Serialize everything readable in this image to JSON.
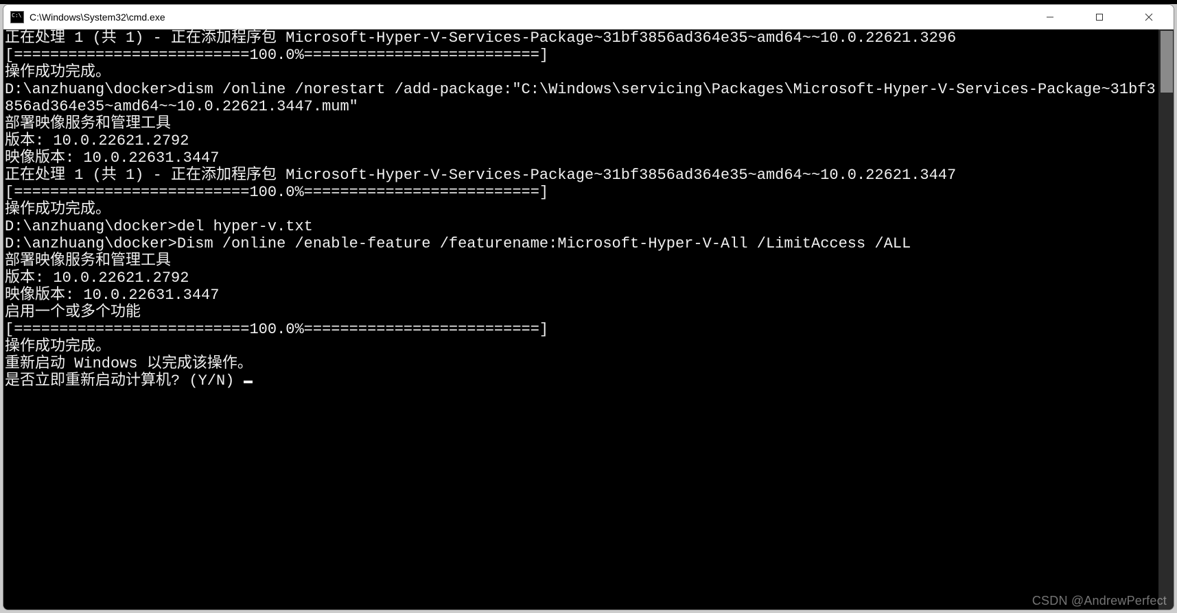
{
  "window": {
    "title": "C:\\Windows\\System32\\cmd.exe"
  },
  "lines": [
    "正在处理 1 (共 1) - 正在添加程序包 Microsoft-Hyper-V-Services-Package~31bf3856ad364e35~amd64~~10.0.22621.3296",
    "[==========================100.0%==========================]",
    "操作成功完成。",
    "",
    "D:\\anzhuang\\docker>dism /online /norestart /add-package:\"C:\\Windows\\servicing\\Packages\\Microsoft-Hyper-V-Services-Package~31bf3856ad364e35~amd64~~10.0.22621.3447.mum\"",
    "",
    "部署映像服务和管理工具",
    "版本: 10.0.22621.2792",
    "",
    "映像版本: 10.0.22631.3447",
    "",
    "正在处理 1 (共 1) - 正在添加程序包 Microsoft-Hyper-V-Services-Package~31bf3856ad364e35~amd64~~10.0.22621.3447",
    "[==========================100.0%==========================]",
    "操作成功完成。",
    "",
    "D:\\anzhuang\\docker>del hyper-v.txt",
    "",
    "D:\\anzhuang\\docker>Dism /online /enable-feature /featurename:Microsoft-Hyper-V-All /LimitAccess /ALL",
    "",
    "部署映像服务和管理工具",
    "版本: 10.0.22621.2792",
    "",
    "映像版本: 10.0.22631.3447",
    "",
    "启用一个或多个功能",
    "[==========================100.0%==========================]",
    "操作成功完成。",
    "重新启动 Windows 以完成该操作。",
    "是否立即重新启动计算机? (Y/N) "
  ],
  "watermark": "CSDN @AndrewPerfect"
}
